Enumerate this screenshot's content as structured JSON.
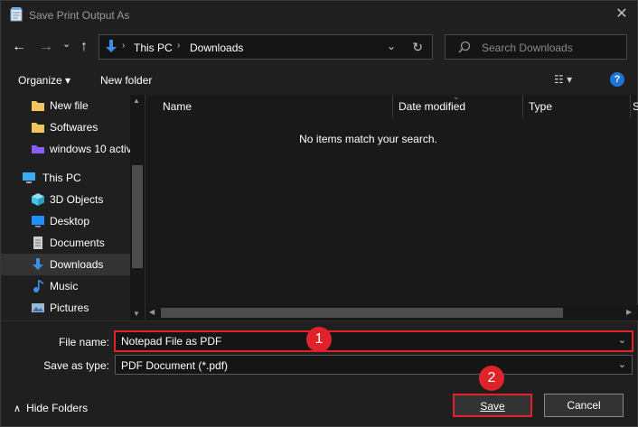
{
  "window": {
    "title": "Save Print Output As",
    "close_glyph": "✕"
  },
  "nav": {
    "back_glyph": "←",
    "forward_glyph": "→",
    "recent_glyph": "⌄",
    "up_glyph": "↑",
    "breadcrumb": [
      "This PC",
      "Downloads"
    ],
    "sep_glyph": "›",
    "dropdown_glyph": "⌄",
    "refresh_glyph": "↻"
  },
  "search": {
    "placeholder": "Search Downloads"
  },
  "toolbar": {
    "organize_label": "Organize ▾",
    "new_folder_label": "New folder",
    "view_glyph": "☷ ▾",
    "help_glyph": "?"
  },
  "sidebar": {
    "items": [
      {
        "label": "New file",
        "icon": "folder-icon",
        "color": "#f3c65d"
      },
      {
        "label": "Softwares",
        "icon": "folder-icon",
        "color": "#f3c65d"
      },
      {
        "label": "windows 10 activ",
        "icon": "folder-purple-icon",
        "color": "#8b5cf6"
      },
      {
        "label": "This PC",
        "icon": "computer-icon",
        "color": "#3fa9f5"
      },
      {
        "label": "3D Objects",
        "icon": "cube-icon",
        "color": "#45c4e8"
      },
      {
        "label": "Desktop",
        "icon": "desktop-icon",
        "color": "#1e90ff"
      },
      {
        "label": "Documents",
        "icon": "document-icon",
        "color": "#cfcfcf"
      },
      {
        "label": "Downloads",
        "icon": "download-icon",
        "color": "#3b8ee8"
      },
      {
        "label": "Music",
        "icon": "music-icon",
        "color": "#3b8ee8"
      },
      {
        "label": "Pictures",
        "icon": "pictures-icon",
        "color": "#9fb7d6"
      }
    ]
  },
  "filelist": {
    "columns": [
      "Name",
      "Date modified",
      "Type",
      "S"
    ],
    "empty_message": "No items match your search."
  },
  "form": {
    "file_name_label": "File name:",
    "file_name_value": "Notepad File as PDF",
    "save_type_label": "Save as type:",
    "save_type_value": "PDF Document (*.pdf)",
    "combo_arrow": "⌄",
    "hide_folders_label": "Hide Folders",
    "hide_folders_glyph": "∧",
    "save_label": "Save",
    "cancel_label": "Cancel"
  },
  "annotations": {
    "badge_1": "1",
    "badge_2": "2",
    "color": "#e0232a"
  }
}
